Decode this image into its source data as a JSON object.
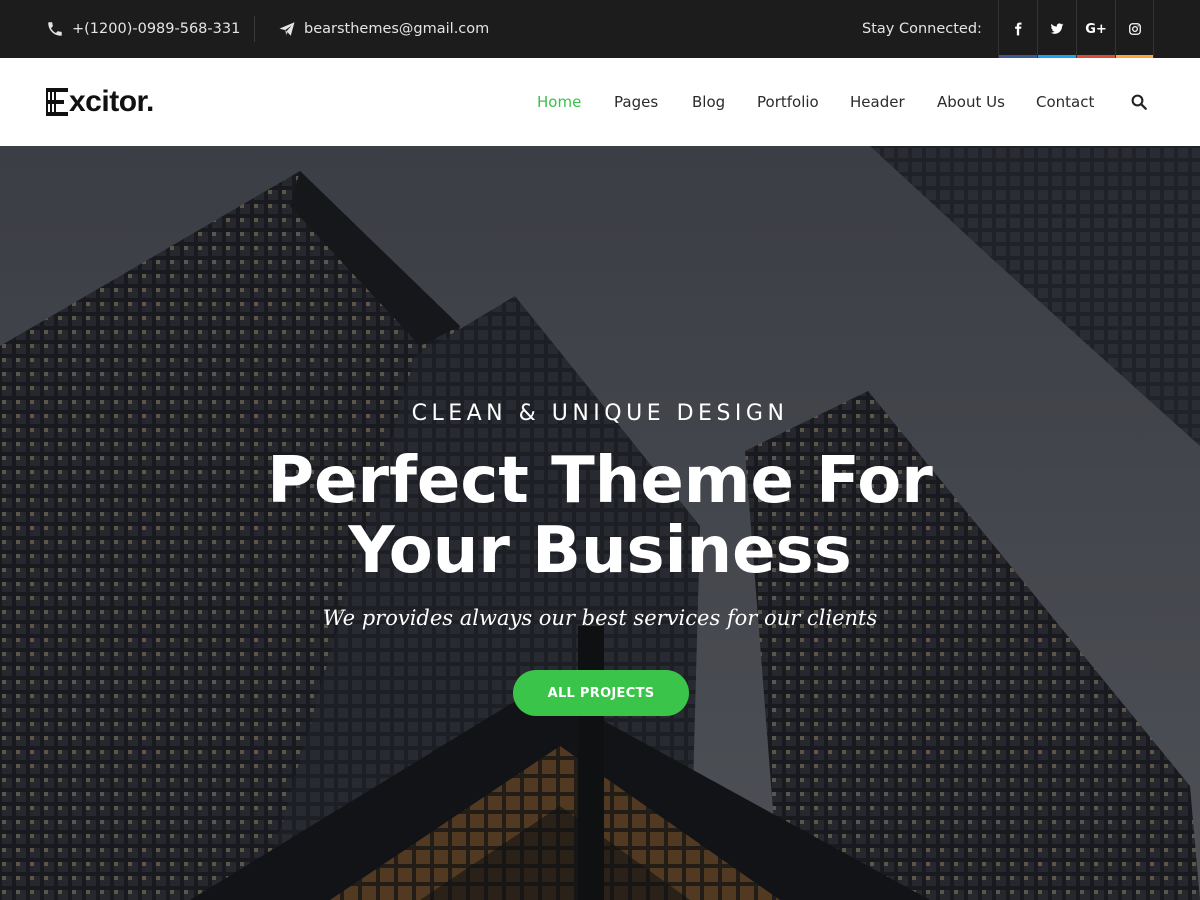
{
  "topbar": {
    "phone": "+(1200)-0989-568-331",
    "email": "bearsthemes@gmail.com",
    "stay_connected": "Stay Connected:",
    "socials": [
      {
        "icon": "facebook-icon",
        "glyph": "f",
        "color": "#3b5998"
      },
      {
        "icon": "twitter-icon",
        "glyph": "t",
        "color": "#1da1f2"
      },
      {
        "icon": "google-plus-icon",
        "glyph": "G+",
        "color": "#dd4b39"
      },
      {
        "icon": "instagram-icon",
        "glyph": "ig",
        "color": "#f7a83b"
      }
    ]
  },
  "header": {
    "logo": "Excitor.",
    "logo_rest": "xcitor.",
    "nav": [
      "Home",
      "Pages",
      "Blog",
      "Portfolio",
      "Header",
      "About Us",
      "Contact"
    ],
    "active_nav": "Home",
    "accent": "#3bbf4d"
  },
  "hero": {
    "kicker": "CLEAN & UNIQUE DESIGN",
    "headline_line1": "Perfect Theme For",
    "headline_line2": "Your Business",
    "subline": "We provides always our best services for our clients",
    "cta": "ALL PROJECTS",
    "cta_color": "#3ac449"
  }
}
